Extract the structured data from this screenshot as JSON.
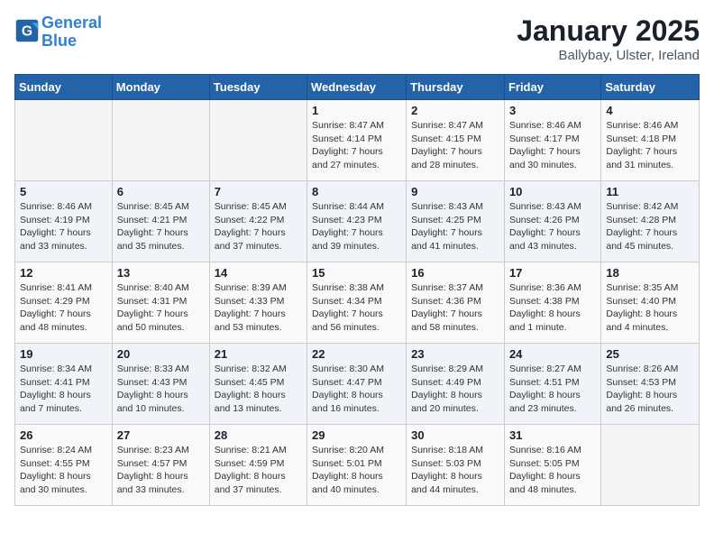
{
  "header": {
    "logo_line1": "General",
    "logo_line2": "Blue",
    "month": "January 2025",
    "location": "Ballybay, Ulster, Ireland"
  },
  "weekdays": [
    "Sunday",
    "Monday",
    "Tuesday",
    "Wednesday",
    "Thursday",
    "Friday",
    "Saturday"
  ],
  "weeks": [
    [
      {
        "day": "",
        "info": ""
      },
      {
        "day": "",
        "info": ""
      },
      {
        "day": "",
        "info": ""
      },
      {
        "day": "1",
        "info": "Sunrise: 8:47 AM\nSunset: 4:14 PM\nDaylight: 7 hours and 27 minutes."
      },
      {
        "day": "2",
        "info": "Sunrise: 8:47 AM\nSunset: 4:15 PM\nDaylight: 7 hours and 28 minutes."
      },
      {
        "day": "3",
        "info": "Sunrise: 8:46 AM\nSunset: 4:17 PM\nDaylight: 7 hours and 30 minutes."
      },
      {
        "day": "4",
        "info": "Sunrise: 8:46 AM\nSunset: 4:18 PM\nDaylight: 7 hours and 31 minutes."
      }
    ],
    [
      {
        "day": "5",
        "info": "Sunrise: 8:46 AM\nSunset: 4:19 PM\nDaylight: 7 hours and 33 minutes."
      },
      {
        "day": "6",
        "info": "Sunrise: 8:45 AM\nSunset: 4:21 PM\nDaylight: 7 hours and 35 minutes."
      },
      {
        "day": "7",
        "info": "Sunrise: 8:45 AM\nSunset: 4:22 PM\nDaylight: 7 hours and 37 minutes."
      },
      {
        "day": "8",
        "info": "Sunrise: 8:44 AM\nSunset: 4:23 PM\nDaylight: 7 hours and 39 minutes."
      },
      {
        "day": "9",
        "info": "Sunrise: 8:43 AM\nSunset: 4:25 PM\nDaylight: 7 hours and 41 minutes."
      },
      {
        "day": "10",
        "info": "Sunrise: 8:43 AM\nSunset: 4:26 PM\nDaylight: 7 hours and 43 minutes."
      },
      {
        "day": "11",
        "info": "Sunrise: 8:42 AM\nSunset: 4:28 PM\nDaylight: 7 hours and 45 minutes."
      }
    ],
    [
      {
        "day": "12",
        "info": "Sunrise: 8:41 AM\nSunset: 4:29 PM\nDaylight: 7 hours and 48 minutes."
      },
      {
        "day": "13",
        "info": "Sunrise: 8:40 AM\nSunset: 4:31 PM\nDaylight: 7 hours and 50 minutes."
      },
      {
        "day": "14",
        "info": "Sunrise: 8:39 AM\nSunset: 4:33 PM\nDaylight: 7 hours and 53 minutes."
      },
      {
        "day": "15",
        "info": "Sunrise: 8:38 AM\nSunset: 4:34 PM\nDaylight: 7 hours and 56 minutes."
      },
      {
        "day": "16",
        "info": "Sunrise: 8:37 AM\nSunset: 4:36 PM\nDaylight: 7 hours and 58 minutes."
      },
      {
        "day": "17",
        "info": "Sunrise: 8:36 AM\nSunset: 4:38 PM\nDaylight: 8 hours and 1 minute."
      },
      {
        "day": "18",
        "info": "Sunrise: 8:35 AM\nSunset: 4:40 PM\nDaylight: 8 hours and 4 minutes."
      }
    ],
    [
      {
        "day": "19",
        "info": "Sunrise: 8:34 AM\nSunset: 4:41 PM\nDaylight: 8 hours and 7 minutes."
      },
      {
        "day": "20",
        "info": "Sunrise: 8:33 AM\nSunset: 4:43 PM\nDaylight: 8 hours and 10 minutes."
      },
      {
        "day": "21",
        "info": "Sunrise: 8:32 AM\nSunset: 4:45 PM\nDaylight: 8 hours and 13 minutes."
      },
      {
        "day": "22",
        "info": "Sunrise: 8:30 AM\nSunset: 4:47 PM\nDaylight: 8 hours and 16 minutes."
      },
      {
        "day": "23",
        "info": "Sunrise: 8:29 AM\nSunset: 4:49 PM\nDaylight: 8 hours and 20 minutes."
      },
      {
        "day": "24",
        "info": "Sunrise: 8:27 AM\nSunset: 4:51 PM\nDaylight: 8 hours and 23 minutes."
      },
      {
        "day": "25",
        "info": "Sunrise: 8:26 AM\nSunset: 4:53 PM\nDaylight: 8 hours and 26 minutes."
      }
    ],
    [
      {
        "day": "26",
        "info": "Sunrise: 8:24 AM\nSunset: 4:55 PM\nDaylight: 8 hours and 30 minutes."
      },
      {
        "day": "27",
        "info": "Sunrise: 8:23 AM\nSunset: 4:57 PM\nDaylight: 8 hours and 33 minutes."
      },
      {
        "day": "28",
        "info": "Sunrise: 8:21 AM\nSunset: 4:59 PM\nDaylight: 8 hours and 37 minutes."
      },
      {
        "day": "29",
        "info": "Sunrise: 8:20 AM\nSunset: 5:01 PM\nDaylight: 8 hours and 40 minutes."
      },
      {
        "day": "30",
        "info": "Sunrise: 8:18 AM\nSunset: 5:03 PM\nDaylight: 8 hours and 44 minutes."
      },
      {
        "day": "31",
        "info": "Sunrise: 8:16 AM\nSunset: 5:05 PM\nDaylight: 8 hours and 48 minutes."
      },
      {
        "day": "",
        "info": ""
      }
    ]
  ]
}
